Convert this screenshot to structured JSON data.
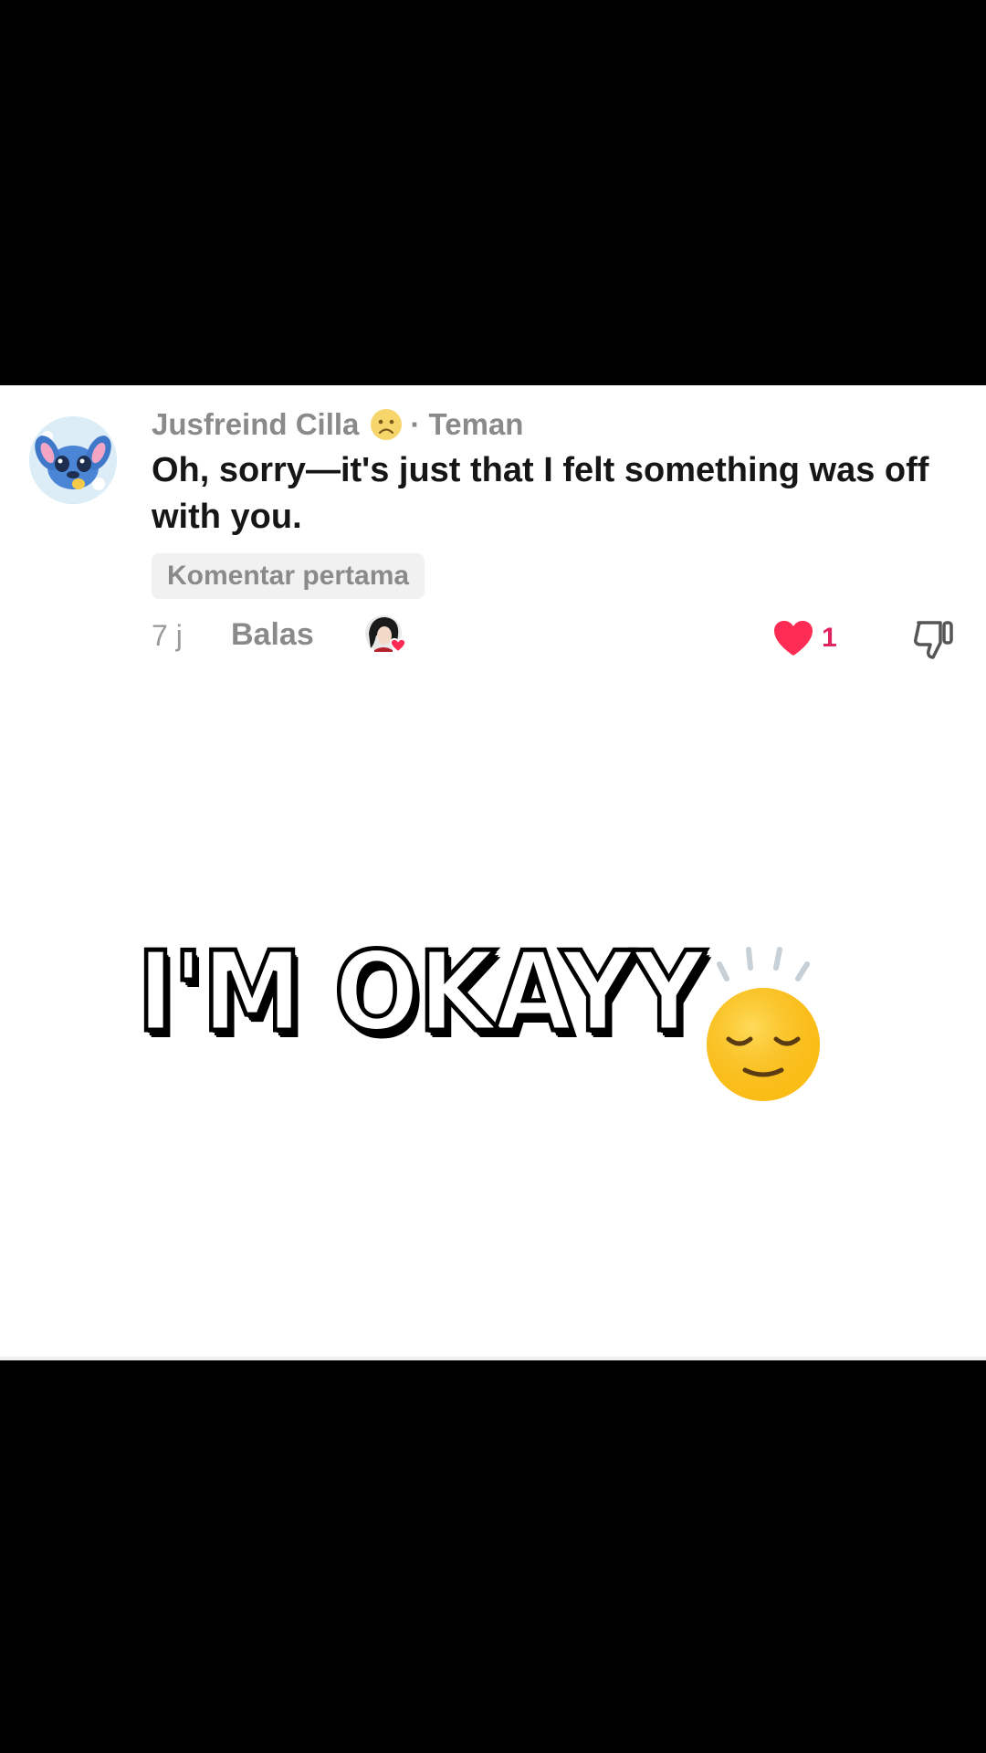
{
  "comment": {
    "author": "Jusfreind Cilla",
    "relation": "· Teman",
    "text": "Oh, sorry—it's just that I felt something was off with you.",
    "badge": "Komentar pertama",
    "time": "7 j",
    "reply_label": "Balas",
    "like_count": "1"
  },
  "overlay": {
    "caption": "I'M OKAYY"
  },
  "icons": {
    "author_emoji": "sad-face-icon",
    "heart": "heart-icon",
    "dislike": "thumbs-down-icon",
    "caption_emoji": "relieved-face-icon"
  },
  "colors": {
    "like": "#e0245e",
    "meta_gray": "#8a8a8a",
    "text": "#161616"
  }
}
